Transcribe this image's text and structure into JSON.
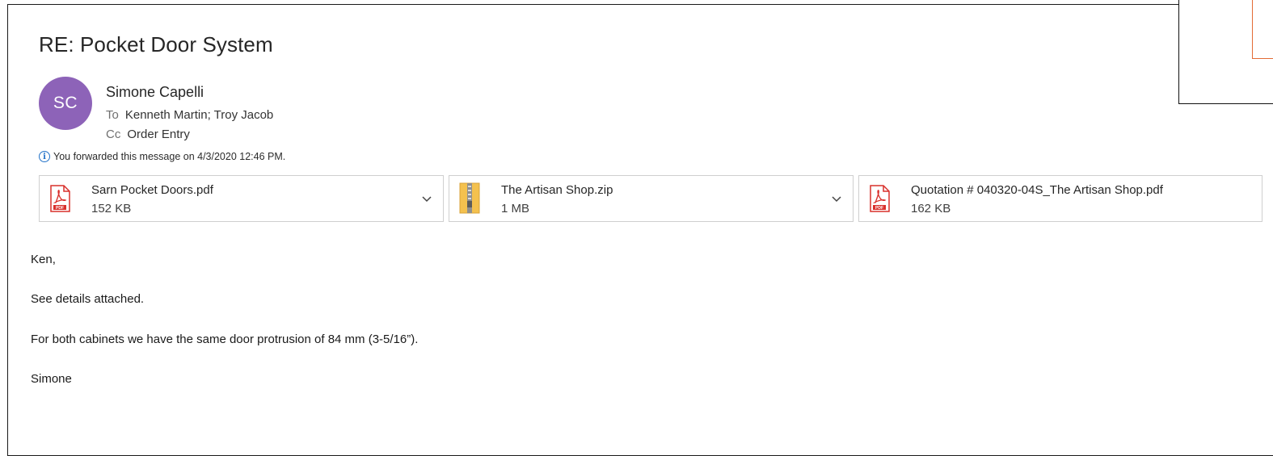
{
  "email": {
    "subject": "RE: Pocket Door System",
    "avatar_initials": "SC",
    "avatar_color": "#8d63b8",
    "sender": "Simone Capelli",
    "to_label": "To",
    "to_value": "Kenneth Martin; Troy Jacob",
    "cc_label": "Cc",
    "cc_value": "Order Entry",
    "info_text": "You forwarded this message on 4/3/2020 12:46 PM."
  },
  "attachments": [
    {
      "name": "Sarn Pocket Doors.pdf",
      "size": "152 KB",
      "icon": "pdf-icon"
    },
    {
      "name": "The Artisan Shop.zip",
      "size": "1 MB",
      "icon": "zip-folder-icon"
    },
    {
      "name": "Quotation # 040320-04S_The Artisan Shop.pdf",
      "size": "162 KB",
      "icon": "pdf-icon"
    }
  ],
  "body": {
    "greeting": "Ken,",
    "line1": "See details attached.",
    "line2": "For both cabinets we have the same door protrusion of 84 mm (3-5/16”).",
    "signature": "Simone"
  },
  "colors": {
    "pdf_red": "#d9302c",
    "info_blue": "#2372c8",
    "zip_yellow": "#f4c14e"
  }
}
